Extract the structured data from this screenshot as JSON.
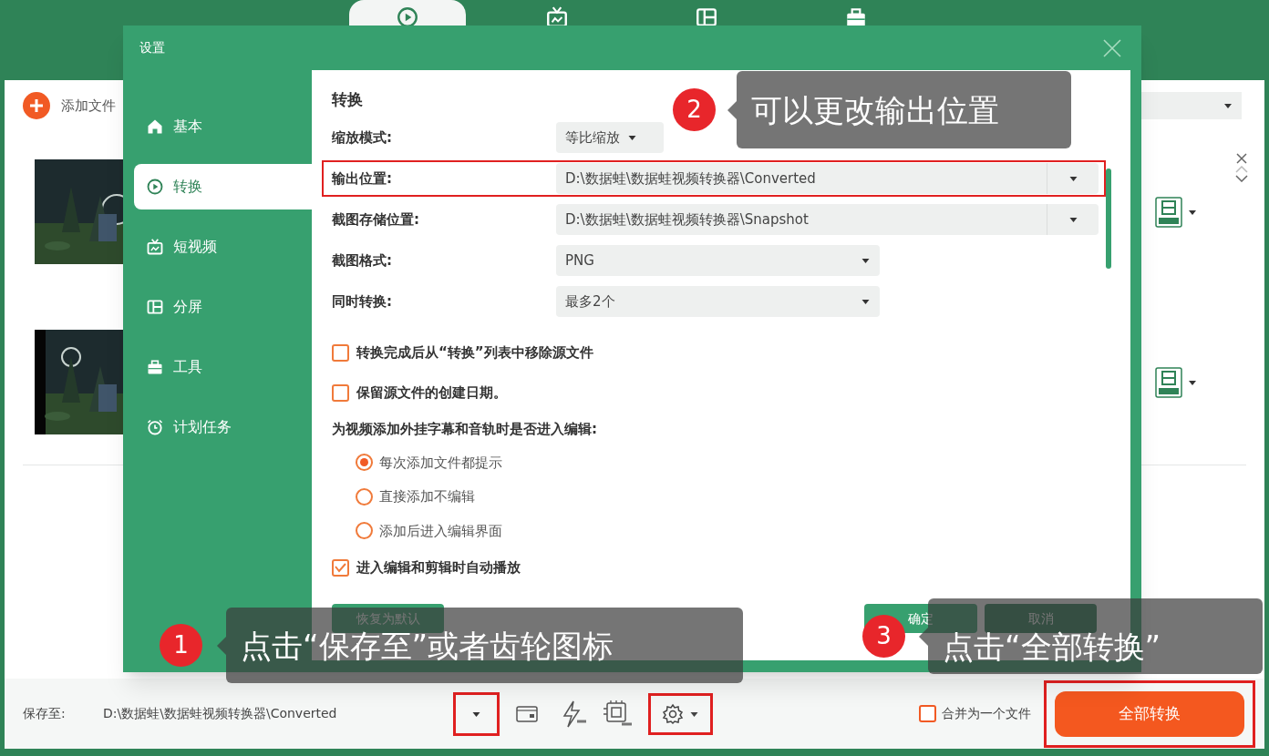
{
  "top_tabs": [
    {
      "kind": "convert",
      "selected": true
    },
    {
      "kind": "tv",
      "selected": false
    },
    {
      "kind": "split",
      "selected": false
    },
    {
      "kind": "toolbox",
      "selected": false
    }
  ],
  "add_file_button": "添加文件",
  "bottom_bar": {
    "save_to_label": "保存至:",
    "save_path": "D:\\数据蛙\\数据蛙视频转换器\\Converted",
    "path_dropdown": {
      "highlighted": true
    },
    "settings": {
      "highlighted": true
    },
    "merge": {
      "label": "合并为一个文件",
      "checked": false
    },
    "convert_all": {
      "label": "全部转换",
      "highlighted": true
    }
  },
  "dialog": {
    "title": "设置",
    "nav": [
      {
        "kind": "home",
        "label": "基本",
        "selected": false
      },
      {
        "kind": "convert",
        "label": "转换",
        "selected": true
      },
      {
        "kind": "tv",
        "label": "短视频",
        "selected": false
      },
      {
        "kind": "split",
        "label": "分屏",
        "selected": false
      },
      {
        "kind": "toolbox",
        "label": "工具",
        "selected": false
      },
      {
        "kind": "clock",
        "label": "计划任务",
        "selected": false
      }
    ],
    "section_title": "转换",
    "fields": [
      {
        "kind": "short",
        "label": "缩放模式:",
        "value": "等比缩放",
        "highlighted": false
      },
      {
        "kind": "path",
        "label": "输出位置:",
        "value": "D:\\数据蛙\\数据蛙视频转换器\\Converted",
        "highlighted": true
      },
      {
        "kind": "path",
        "label": "截图存储位置:",
        "value": "D:\\数据蛙\\数据蛙视频转换器\\Snapshot",
        "highlighted": false
      },
      {
        "kind": "medium",
        "label": "截图格式:",
        "value": "PNG",
        "highlighted": false
      },
      {
        "kind": "medium",
        "label": "同时转换:",
        "value": "最多2个",
        "highlighted": false
      }
    ],
    "options": [
      {
        "kind": "checkbox",
        "label": "转换完成后从“转换”列表中移除源文件",
        "checked": false
      },
      {
        "kind": "checkbox",
        "label": "保留源文件的创建日期。",
        "checked": false
      },
      {
        "kind": "heading",
        "label": "为视频添加外挂字幕和音轨时是否进入编辑:"
      },
      {
        "kind": "radio",
        "label": "每次添加文件都提示",
        "selected": true
      },
      {
        "kind": "radio",
        "label": "直接添加不编辑",
        "selected": false
      },
      {
        "kind": "radio",
        "label": "添加后进入编辑界面",
        "selected": false
      },
      {
        "kind": "checkbox",
        "label": "进入编辑和剪辑时自动播放",
        "checked": true
      }
    ],
    "buttons": {
      "reset": "恢复为默认",
      "ok": "确定",
      "cancel": "取消"
    }
  },
  "callouts": [
    {
      "number": "2",
      "text": "可以更改输出位置"
    },
    {
      "number": "1",
      "text": "点击“保存至”或者齿轮图标"
    },
    {
      "number": "3",
      "text": "点击“全部转换”"
    }
  ]
}
